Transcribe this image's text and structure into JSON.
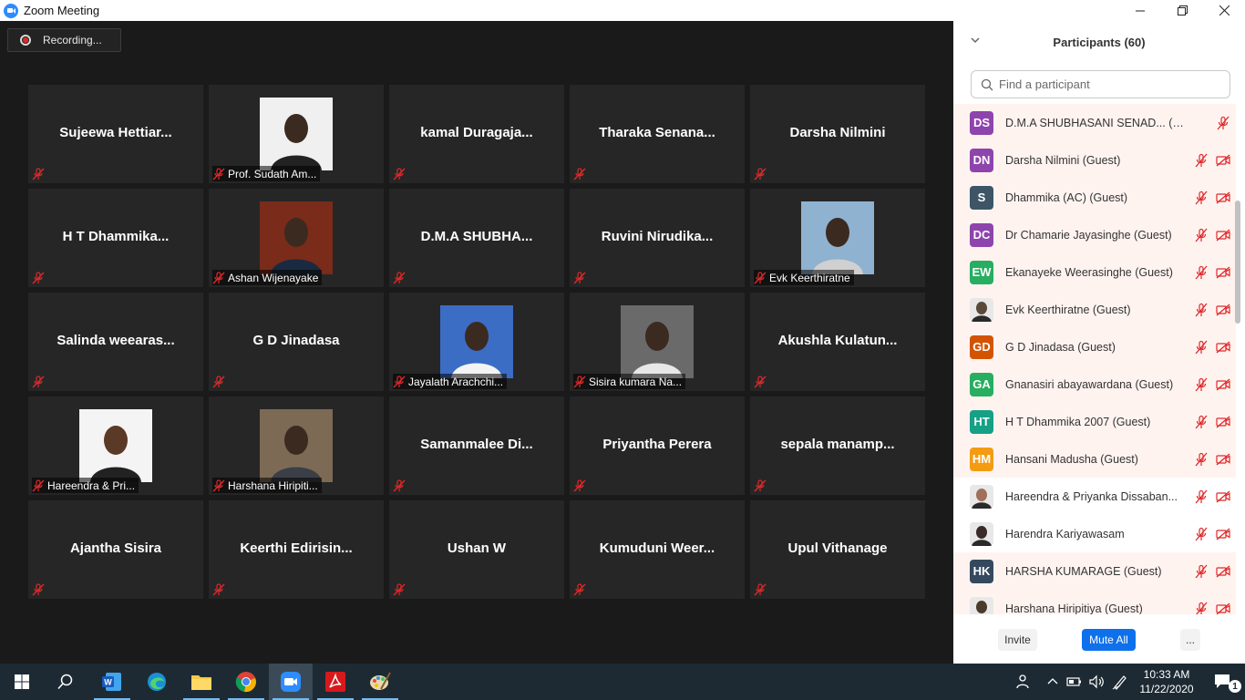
{
  "window": {
    "title": "Zoom Meeting"
  },
  "recording": {
    "label": "Recording..."
  },
  "tiles": [
    {
      "name": "Sujeewa  Hettiar...",
      "label": "",
      "photo": false
    },
    {
      "name": "",
      "label": "Prof. Sudath Am...",
      "photo": true
    },
    {
      "name": "kamal  Duragaja...",
      "label": "",
      "photo": false
    },
    {
      "name": "Tharaka  Senana...",
      "label": "",
      "photo": false
    },
    {
      "name": "Darsha Nilmini",
      "label": "",
      "photo": false
    },
    {
      "name": "H  T  Dhammika...",
      "label": "",
      "photo": false
    },
    {
      "name": "",
      "label": "Ashan Wijenayake",
      "photo": true
    },
    {
      "name": "D.M.A  SHUBHA...",
      "label": "",
      "photo": false
    },
    {
      "name": "Ruvini  Nirudika...",
      "label": "",
      "photo": false
    },
    {
      "name": "",
      "label": "Evk Keerthiratne",
      "photo": true
    },
    {
      "name": "Salinda  weearas...",
      "label": "",
      "photo": false
    },
    {
      "name": "G D Jinadasa",
      "label": "",
      "photo": false
    },
    {
      "name": "",
      "label": "Jayalath Arachchi...",
      "photo": true
    },
    {
      "name": "",
      "label": "Sisira kumara Na...",
      "photo": true
    },
    {
      "name": "Akushla  Kulatun...",
      "label": "",
      "photo": false
    },
    {
      "name": "",
      "label": "Hareendra & Pri...",
      "photo": true
    },
    {
      "name": "",
      "label": "Harshana Hiripiti...",
      "photo": true
    },
    {
      "name": "Samanmalee  Di...",
      "label": "",
      "photo": false
    },
    {
      "name": "Priyantha Perera",
      "label": "",
      "photo": false
    },
    {
      "name": "sepala  manamp...",
      "label": "",
      "photo": false
    },
    {
      "name": "Ajantha Sisira",
      "label": "",
      "photo": false
    },
    {
      "name": "Keerthi  Edirisin...",
      "label": "",
      "photo": false
    },
    {
      "name": "Ushan W",
      "label": "",
      "photo": false
    },
    {
      "name": "Kumuduni  Weer...",
      "label": "",
      "photo": false
    },
    {
      "name": "Upul Vithanage",
      "label": "",
      "photo": false
    }
  ],
  "panel": {
    "title": "Participants (60)",
    "search_placeholder": "Find a participant",
    "participants": [
      {
        "initials": "DS",
        "color": "#8e44ad",
        "name": "D.M.A SHUBHASANI SENAD...  (Guest)",
        "video": false,
        "highlight": true
      },
      {
        "initials": "DN",
        "color": "#8e44ad",
        "name": "Darsha Nilmini (Guest)",
        "video": true,
        "highlight": true
      },
      {
        "initials": "S",
        "color": "#3d5566",
        "name": "Dhammika (AC) (Guest)",
        "video": true,
        "highlight": true
      },
      {
        "initials": "DC",
        "color": "#8e44ad",
        "name": "Dr Chamarie Jayasinghe (Guest)",
        "video": true,
        "highlight": true
      },
      {
        "initials": "EW",
        "color": "#27ae60",
        "name": "Ekanayeke Weerasinghe (Guest)",
        "video": true,
        "highlight": true
      },
      {
        "initials": "",
        "color": "#5a4a3a",
        "name": "Evk Keerthiratne (Guest)",
        "video": true,
        "highlight": true
      },
      {
        "initials": "GD",
        "color": "#d35400",
        "name": "G D Jinadasa (Guest)",
        "video": true,
        "highlight": true
      },
      {
        "initials": "GA",
        "color": "#27ae60",
        "name": "Gnanasiri abayawardana (Guest)",
        "video": true,
        "highlight": true
      },
      {
        "initials": "HT",
        "color": "#16a085",
        "name": "H T Dhammika 2007 (Guest)",
        "video": true,
        "highlight": true
      },
      {
        "initials": "HM",
        "color": "#f39c12",
        "name": "Hansani Madusha (Guest)",
        "video": true,
        "highlight": true
      },
      {
        "initials": "",
        "color": "#a0705a",
        "name": "Hareendra & Priyanka Dissaban...",
        "video": true,
        "highlight": false
      },
      {
        "initials": "",
        "color": "#3a2a2a",
        "name": "Harendra Kariyawasam",
        "video": true,
        "highlight": false
      },
      {
        "initials": "HK",
        "color": "#34495e",
        "name": "HARSHA KUMARAGE (Guest)",
        "video": true,
        "highlight": true
      },
      {
        "initials": "",
        "color": "#4a3a2a",
        "name": "Harshana Hiripitiya (Guest)",
        "video": true,
        "highlight": true
      }
    ],
    "buttons": {
      "invite": "Invite",
      "mute_all": "Mute All",
      "more": "..."
    }
  },
  "taskbar": {
    "time": "10:33 AM",
    "date": "11/22/2020",
    "notification_count": "1",
    "apps": [
      "start-icon",
      "search-icon",
      "word-icon",
      "edge-icon",
      "file-explorer-icon",
      "chrome-icon",
      "zoom-icon",
      "acrobat-icon",
      "paint-icon"
    ]
  }
}
